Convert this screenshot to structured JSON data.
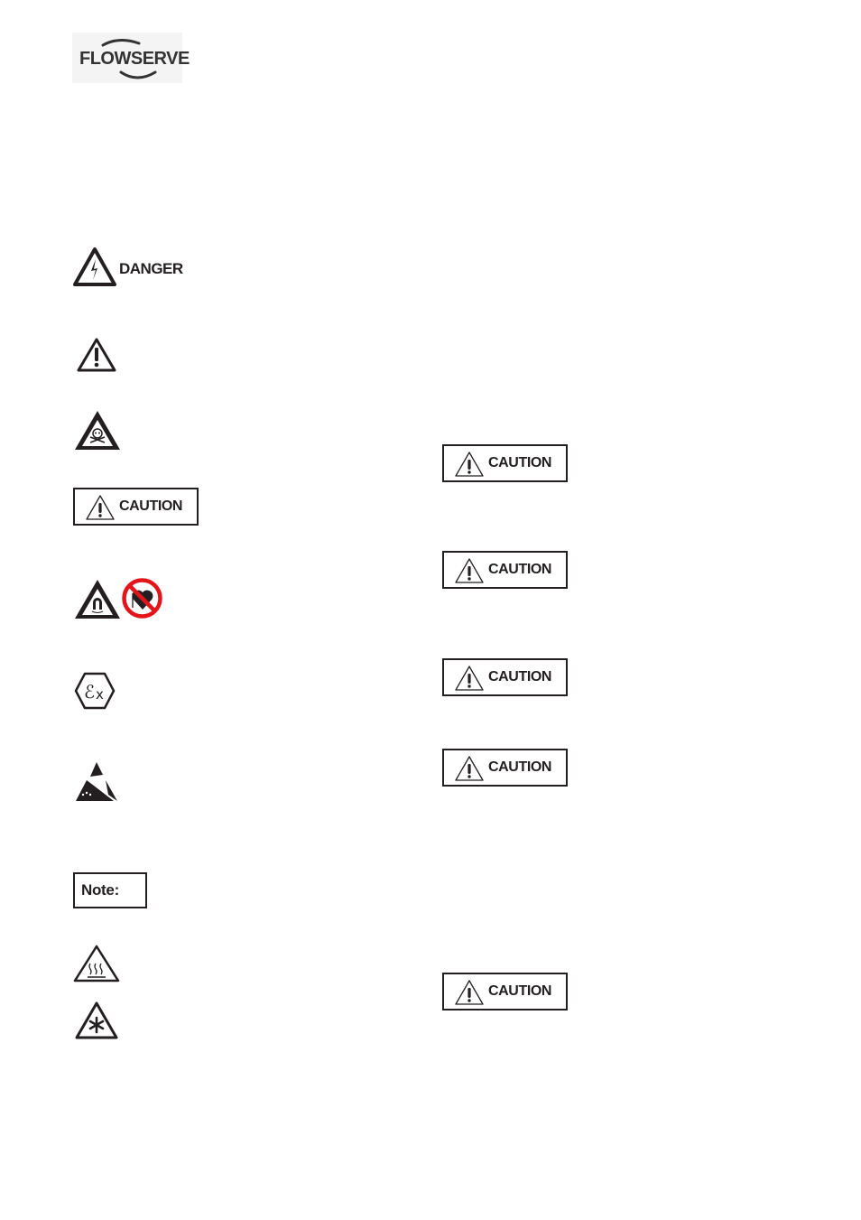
{
  "header": {
    "logo_text": "FLOWSERVE",
    "logo_registered": "®"
  },
  "symbols": {
    "danger_label": "DANGER",
    "caution_label": "CAUTION",
    "note_label": "Note:"
  },
  "colors": {
    "ink": "#231f20",
    "prohibition_red": "#e3151b"
  },
  "left_column": [
    {
      "icon": "electrical-hazard-icon",
      "label": "DANGER"
    },
    {
      "icon": "general-warning-icon"
    },
    {
      "icon": "toxic-hazard-icon"
    },
    {
      "icon": "caution-icon",
      "label": "CAUTION"
    },
    {
      "icon": "magnetic-field-icon"
    },
    {
      "icon": "no-pacemaker-icon"
    },
    {
      "icon": "ex-explosion-proof-icon"
    },
    {
      "icon": "esd-sensitive-icon"
    },
    {
      "icon": "note-label",
      "label": "Note:"
    },
    {
      "icon": "hot-surface-icon"
    },
    {
      "icon": "cold-surface-icon"
    }
  ],
  "right_column": [
    {
      "icon": "caution-icon",
      "label": "CAUTION"
    },
    {
      "icon": "caution-icon",
      "label": "CAUTION"
    },
    {
      "icon": "caution-icon",
      "label": "CAUTION"
    },
    {
      "icon": "caution-icon",
      "label": "CAUTION"
    },
    {
      "icon": "caution-icon",
      "label": "CAUTION"
    }
  ]
}
